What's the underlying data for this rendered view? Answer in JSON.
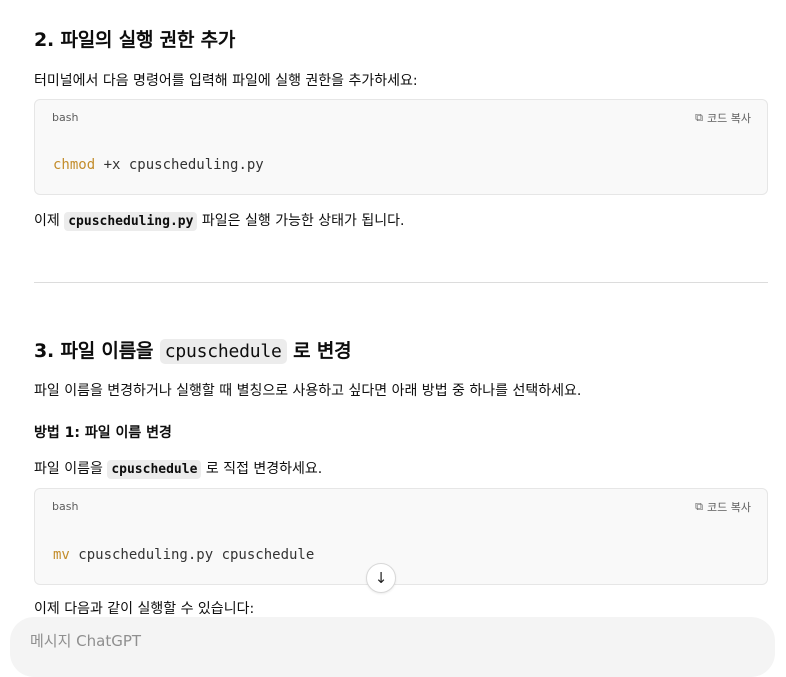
{
  "section2": {
    "heading": "2. 파일의 실행 권한 추가",
    "intro": "터미널에서 다음 명령어를 입력해 파일에 실행 권한을 추가하세요:",
    "code_block": {
      "lang": "bash",
      "copy_label": "코드 복사",
      "command": "chmod",
      "args": " +x cpuscheduling.py"
    },
    "after_code_inline": "cpuscheduling.py",
    "after_prefix": "이제 ",
    "after_suffix": " 파일은 실행 가능한 상태가 됩니다."
  },
  "section3": {
    "heading_prefix": "3. 파일 이름을 ",
    "heading_code": "cpuschedule",
    "heading_suffix": " 로 변경",
    "intro": "파일 이름을 변경하거나 실행할 때 별칭으로 사용하고 싶다면 아래 방법 중 하나를 선택하세요.",
    "method1_title": "방법 1: 파일 이름 변경",
    "method1_prefix": "파일 이름을 ",
    "method1_code": "cpuschedule",
    "method1_suffix": " 로 직접 변경하세요.",
    "code_block": {
      "lang": "bash",
      "copy_label": "코드 복사",
      "command": "mv",
      "args": " cpuscheduling.py cpuschedule"
    },
    "after_text": "이제 다음과 같이 실행할 수 있습니다:"
  },
  "composer": {
    "placeholder": "메시지 ChatGPT"
  },
  "icons": {
    "copy": "copy-icon",
    "scroll_down": "arrow-down-icon"
  },
  "colors": {
    "keyword": "#c38d2c",
    "code_bg": "#f9f9f9",
    "inline_code_bg": "#ececec"
  }
}
